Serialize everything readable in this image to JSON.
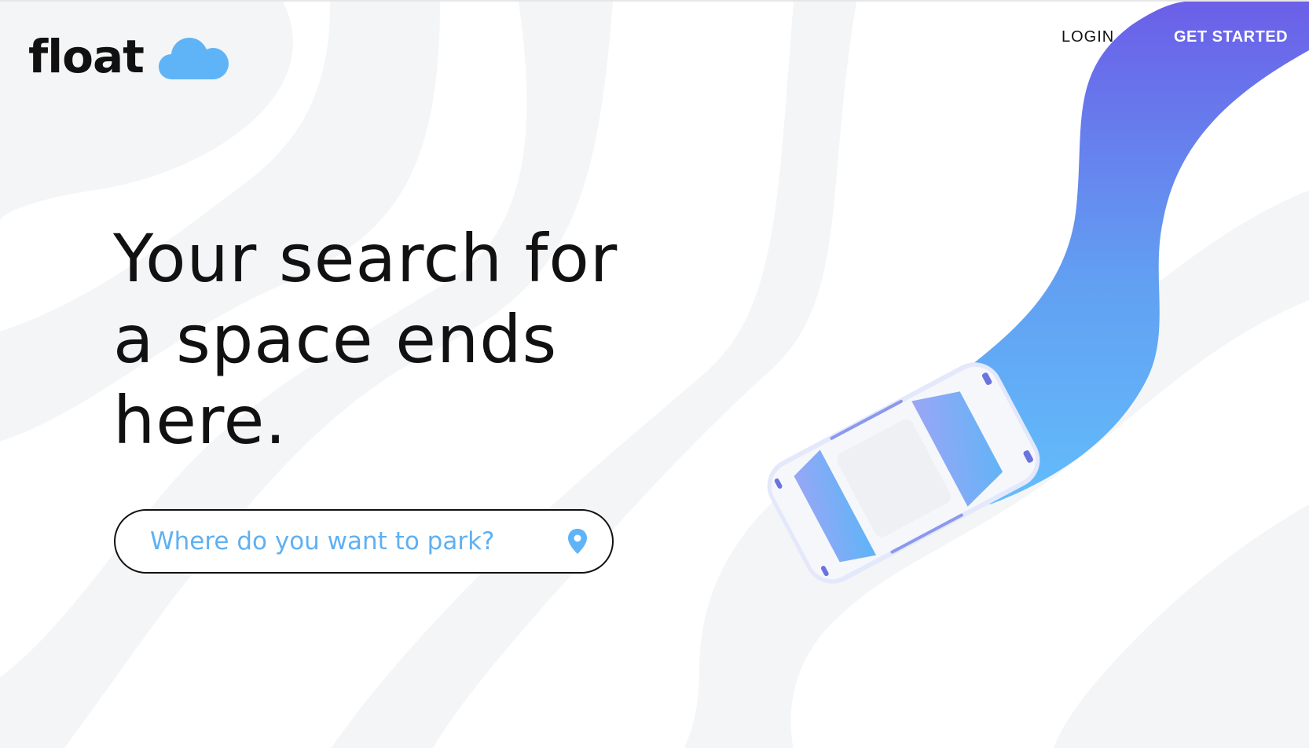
{
  "brand": {
    "name": "float",
    "logo_icon": "cloud-icon",
    "cloud_color": "#5fb4f7"
  },
  "nav": {
    "login_label": "LOGIN",
    "cta_label": "GET STARTED"
  },
  "hero": {
    "title": "Your search for a space ends here."
  },
  "search": {
    "placeholder": "Where do you want to park?",
    "value": "",
    "icon": "map-pin-icon"
  },
  "illustration": {
    "description_icon": "car-icon",
    "road_gradient": [
      "#6a62e8",
      "#62b8f9"
    ],
    "background_wave_color": "#f4f5f6"
  }
}
